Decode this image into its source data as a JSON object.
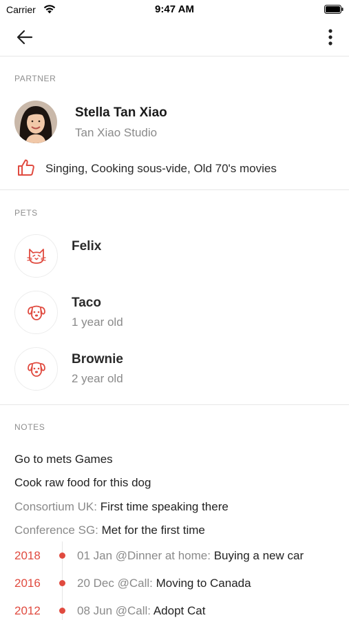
{
  "status_bar": {
    "carrier": "Carrier",
    "time": "9:47 AM"
  },
  "nav": {
    "back_icon": "arrow-left-icon",
    "more_icon": "more-vertical-icon"
  },
  "colors": {
    "accent": "#e04a3f",
    "muted": "#8a8a8a",
    "divider": "#e6e6e6"
  },
  "partner": {
    "section_label": "PARTNER",
    "name": "Stella Tan Xiao",
    "studio": "Tan Xiao Studio",
    "likes_icon": "thumbs-up-icon",
    "likes": "Singing, Cooking sous-vide, Old 70's movies"
  },
  "pets": {
    "section_label": "PETS",
    "items": [
      {
        "name": "Felix",
        "age": "",
        "icon": "cat-icon"
      },
      {
        "name": "Taco",
        "age": "1 year old",
        "icon": "dog-icon"
      },
      {
        "name": "Brownie",
        "age": "2 year old",
        "icon": "dog-icon"
      }
    ]
  },
  "notes": {
    "section_label": "NOTES",
    "plain": [
      "Go to mets Games",
      "Cook raw food for this dog"
    ],
    "keyed": [
      {
        "key": "Consortium UK:",
        "text": " First time speaking there"
      },
      {
        "key": "Conference SG:",
        "text": " Met for the first time"
      }
    ],
    "timeline": [
      {
        "year": "2018",
        "meta": "01 Jan @Dinner at home:",
        "text": " Buying a new car"
      },
      {
        "year": "2016",
        "meta": "20 Dec @Call:",
        "text": " Moving to Canada"
      },
      {
        "year": "2012",
        "meta": "08 Jun @Call:",
        "text": " Adopt Cat"
      }
    ]
  }
}
